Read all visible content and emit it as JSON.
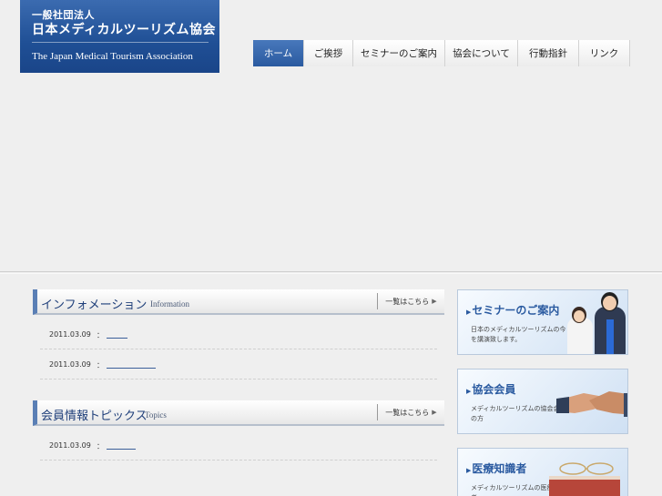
{
  "header": {
    "logo_sub": "一般社団法人",
    "logo_main": "日本メディカルツーリズム協会",
    "logo_en": "The Japan Medical Tourism Association"
  },
  "nav": {
    "items": [
      "ホーム",
      "ご挨拶",
      "セミナーのご案内",
      "協会について",
      "行動指針",
      "リンク"
    ]
  },
  "information": {
    "title": "インフォメーション",
    "title_en": "Information",
    "more_label": "一覧はこちら",
    "rows": [
      {
        "date": "2011.03.09",
        "colon": "："
      },
      {
        "date": "2011.03.09",
        "colon": "："
      }
    ]
  },
  "topics": {
    "title": "会員情報トピックス",
    "title_en": "Topics",
    "more_label": "一覧はこちら",
    "rows": [
      {
        "date": "2011.03.09",
        "colon": "："
      }
    ]
  },
  "banners": [
    {
      "title": "セミナーのご案内",
      "desc": "日本のメディカルツーリズムの今を講演致します。"
    },
    {
      "title": "協会会員",
      "desc": "メディカルツーリズムの協会会員の方"
    },
    {
      "title": "医療知識者",
      "desc": "メディカルツーリズムの医療知識者"
    }
  ],
  "colors": {
    "brand_blue": "#1f4f95",
    "nav_active": "#2a5aa0",
    "background": "#efefef"
  }
}
